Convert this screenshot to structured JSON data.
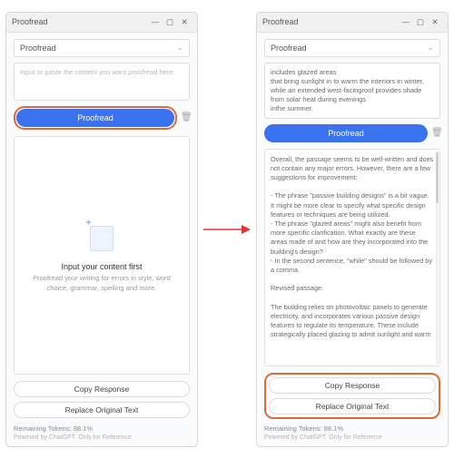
{
  "window": {
    "title": "Proofread"
  },
  "mode_select": {
    "label": "Proofread"
  },
  "left": {
    "placeholder": "Input or paste the content you want proofread here.",
    "proofread_btn": "Proofread",
    "empty_title": "Input your content first",
    "empty_sub": "Proofread your writing for errors in style, word choice, grammar, spelling and more."
  },
  "right": {
    "input_text": "includes glazed areas\nthat bring sunlight in to warm the interiors in winter, while an extended west-facingroof provides shade from solar heat during evenings\ninthe summer.",
    "proofread_btn": "Proofread",
    "result_text": "Overall, the passage seems to be well-written and does not contain any major errors. However, there are a few suggestions for improvement:\n\n- The phrase \"passive building designs\" is a bit vague. It might be more clear to specify what specific design features or techniques are being utilized.\n- The phrase \"glazed areas\" might also benefit from more specific clarification. What exactly are these areas made of and how are they incorporated into the building's design?\n- In the second sentence, \"while\" should be followed by a comma.\n\nRevised passage:\n\nThe building relies on photovoltaic panels to generate electricity, and incorporates various passive design features to regulate its temperature. These include strategically placed glazing to admit sunlight and warm"
  },
  "actions": {
    "copy": "Copy Response",
    "replace": "Replace Original Text"
  },
  "footer": {
    "tokens": "Remaining Tokens: 88.1%",
    "powered": "Powered by ChatGPT. Only for Reference"
  }
}
